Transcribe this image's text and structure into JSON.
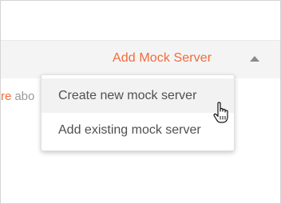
{
  "header": {
    "add_mock_server_label": "Add Mock Server"
  },
  "background_text": {
    "link_fragment": "re",
    "text_fragment": "abo"
  },
  "menu": {
    "items": [
      {
        "label": "Create new mock server",
        "state": "hovered"
      },
      {
        "label": "Add existing mock server",
        "state": "default"
      }
    ]
  },
  "colors": {
    "accent": "#f26b3a",
    "menu_text": "#505050",
    "header_bg": "#f4f4f4",
    "hover_bg": "#f2f2f2"
  },
  "icons": {
    "collapse": "caret-up-icon",
    "pointer": "hand-pointer-cursor-icon"
  }
}
